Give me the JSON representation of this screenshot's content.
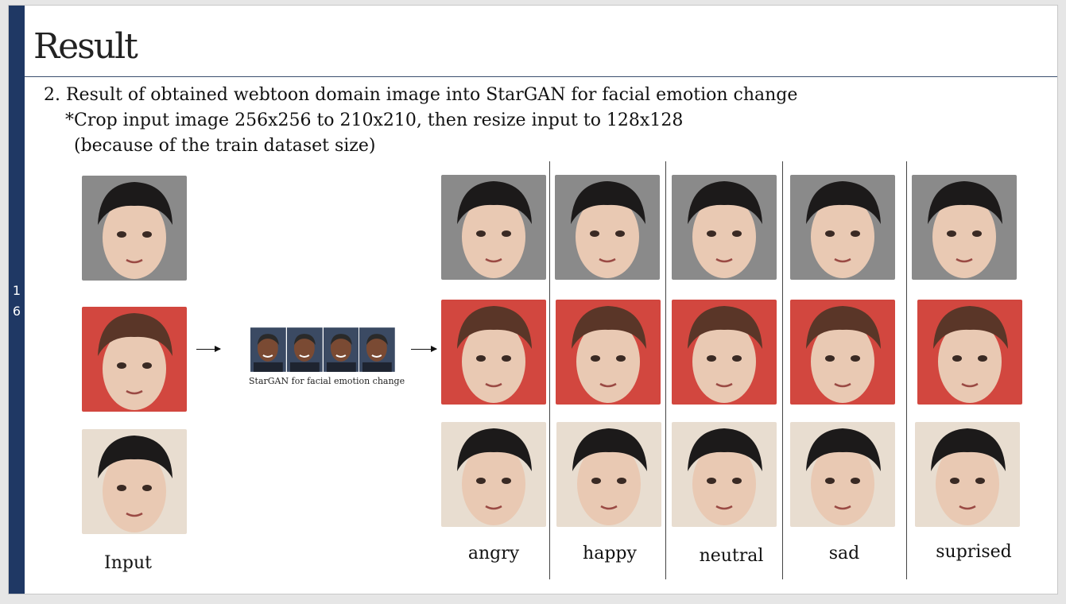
{
  "slide": {
    "number": [
      "1",
      "6"
    ],
    "title": "Result",
    "lines": [
      "2. Result of obtained webtoon domain image into StarGAN for facial emotion change",
      "*Crop input image 256x256 to 210x210, then resize input to 128x128",
      "(because of the train dataset size)"
    ]
  },
  "pipeline": {
    "caption": "StarGAN for facial emotion change"
  },
  "labels": {
    "input": "Input",
    "emotions": [
      "angry",
      "happy",
      "neutral",
      "sad",
      "suprised"
    ]
  },
  "colors": {
    "sidebar": "#1f3864",
    "bg_gray": "#8a8a8a",
    "bg_red": "#d2473f",
    "bg_cream": "#e8ddd0",
    "hair_dark": "#1c1a1a",
    "hair_brown": "#5a3628",
    "skin": "#e9c9b3"
  },
  "icons": [
    "right-arrow-icon",
    "right-arrow-icon"
  ]
}
